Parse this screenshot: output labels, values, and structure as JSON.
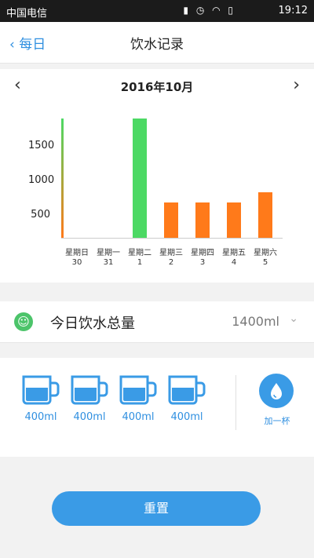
{
  "status": {
    "carrier": "中国电信",
    "time": "19:12"
  },
  "header": {
    "back_label": "每日",
    "title": "饮水记录"
  },
  "chart_header": {
    "month": "2016年10月"
  },
  "chart_data": {
    "type": "bar",
    "categories": [
      "星期日 30",
      "星期一 31",
      "星期二 1",
      "星期三 2",
      "星期四 3",
      "星期五 4",
      "星期六 5"
    ],
    "values": [
      1700,
      0,
      1700,
      500,
      500,
      500,
      650
    ],
    "yticks": [
      500,
      1000,
      1500
    ],
    "ylim": [
      0,
      1750
    ]
  },
  "x_labels": [
    {
      "day": "星期日",
      "date": "30"
    },
    {
      "day": "星期一",
      "date": "31"
    },
    {
      "day": "星期二",
      "date": "1"
    },
    {
      "day": "星期三",
      "date": "2"
    },
    {
      "day": "星期四",
      "date": "3"
    },
    {
      "day": "星期五",
      "date": "4"
    },
    {
      "day": "星期六",
      "date": "5"
    }
  ],
  "colors": {
    "green": "#4cd964",
    "orange": "#ff7a1a",
    "blue": "#3a9be6"
  },
  "total": {
    "label": "今日饮水总量",
    "value": "1400ml"
  },
  "cups": [
    "400ml",
    "400ml",
    "400ml",
    "400ml"
  ],
  "add": {
    "label": "加一杯"
  },
  "reset": {
    "label": "重置"
  }
}
